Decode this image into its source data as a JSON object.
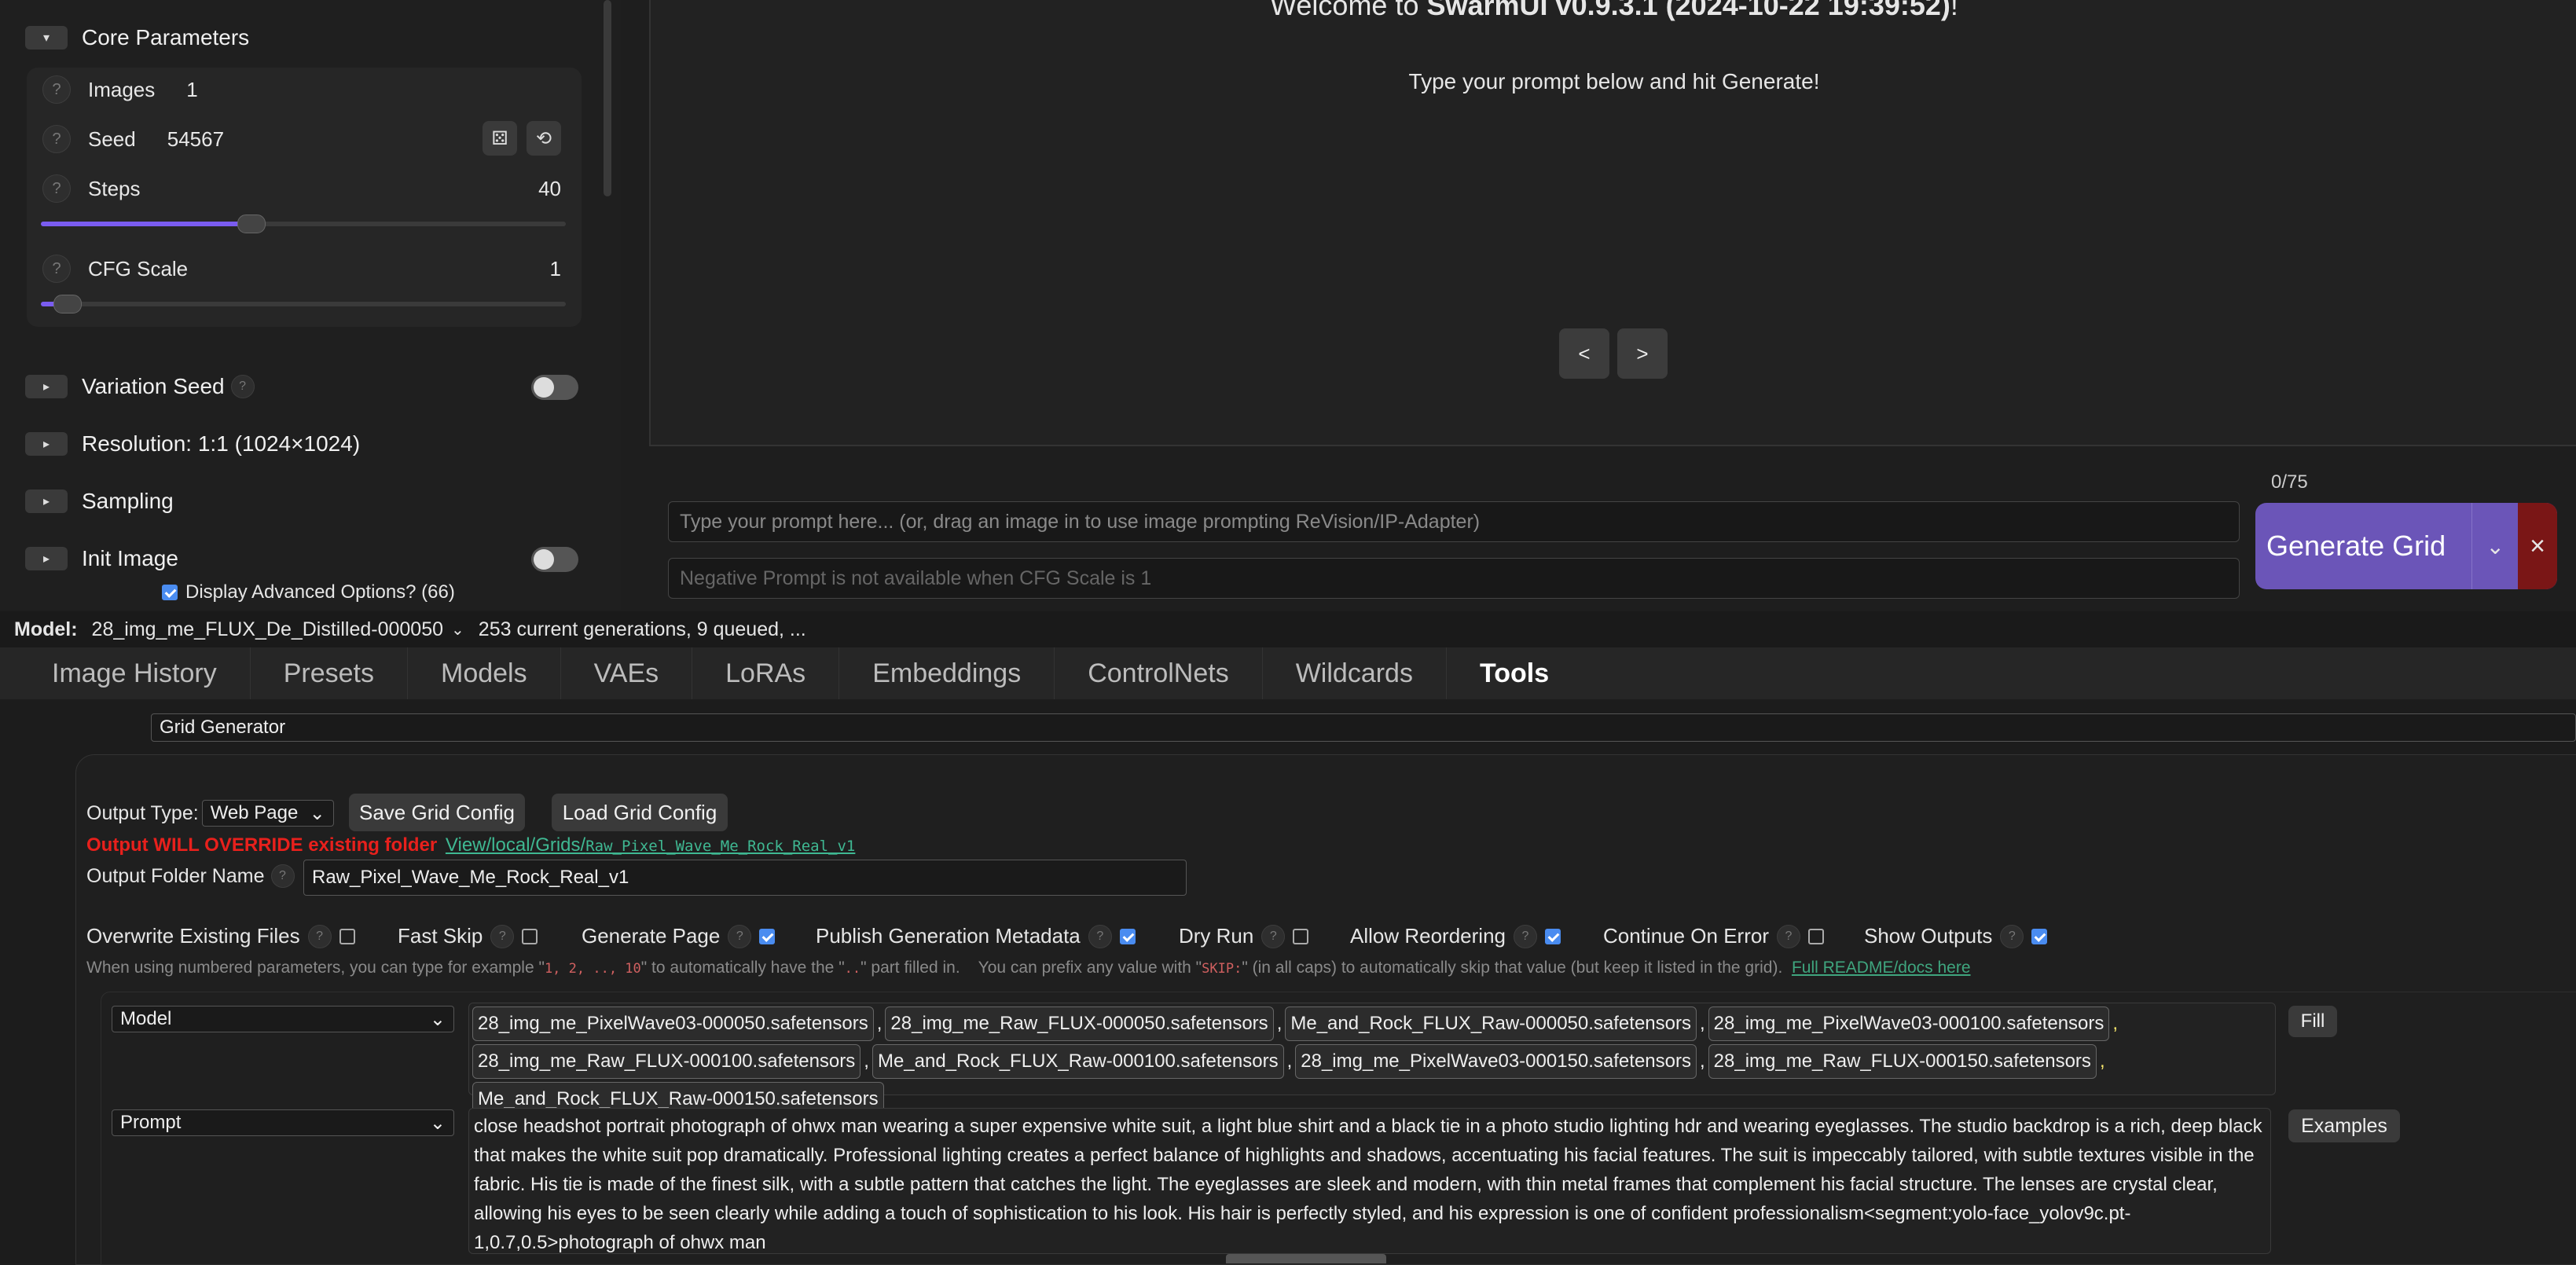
{
  "left_panel": {
    "core_parameters": {
      "label": "Core Parameters",
      "toggle": "▾"
    },
    "images": {
      "label": "Images",
      "value": "1"
    },
    "seed": {
      "label": "Seed",
      "value": "54567"
    },
    "steps": {
      "label": "Steps",
      "value": "40",
      "fill": 0.4
    },
    "cfg_scale": {
      "label": "CFG Scale",
      "value": "1",
      "fill": 0.05
    },
    "variation_seed": {
      "label": "Variation Seed"
    },
    "resolution": {
      "label": "Resolution: 1:1 (1024×1024)"
    },
    "sampling": {
      "label": "Sampling"
    },
    "init_image": {
      "label": "Init Image"
    },
    "advanced": {
      "label": "Display Advanced Options? (66)"
    }
  },
  "preview": {
    "welcome_prefix": "Welcome to ",
    "welcome_bold": "SwarmUI v0.9.3.1 (2024-10-22 19:39:52)",
    "welcome_suffix": "!",
    "hint": "Type your prompt below and hit Generate!",
    "prev": "<",
    "next": ">"
  },
  "prompt": {
    "counter": "0/75",
    "placeholder": "Type your prompt here... (or, drag an image in to use image prompting ReVision/IP-Adapter)",
    "negative": "Negative Prompt is not available when CFG Scale is 1",
    "generate_label": "Generate Grid",
    "close": "×"
  },
  "status": {
    "model_label": "Model:",
    "model_value": "28_img_me_FLUX_De_Distilled-000050",
    "queue": "253 current generations, 9 queued, ..."
  },
  "tabs": [
    "Image History",
    "Presets",
    "Models",
    "VAEs",
    "LoRAs",
    "Embeddings",
    "ControlNets",
    "Wildcards",
    "Tools"
  ],
  "tools": {
    "tool_select": "Grid Generator",
    "output_type_label": "Output Type:",
    "output_type_value": "Web Page",
    "save_config": "Save Grid Config",
    "load_config": "Load Grid Config",
    "override_warning": "Output WILL OVERRIDE existing folder",
    "folder_link": "View/local/Grids/",
    "folder_link_mono": "Raw_Pixel_Wave_Me_Rock_Real_v1",
    "folder_name_label": "Output Folder Name",
    "folder_name_value": "Raw_Pixel_Wave_Me_Rock_Real_v1",
    "options": [
      {
        "label": "Overwrite Existing Files",
        "checked": false
      },
      {
        "label": "Fast Skip",
        "checked": false
      },
      {
        "label": "Generate Page",
        "checked": true
      },
      {
        "label": "Publish Generation Metadata",
        "checked": true
      },
      {
        "label": "Dry Run",
        "checked": false
      },
      {
        "label": "Allow Reordering",
        "checked": true
      },
      {
        "label": "Continue On Error",
        "checked": false
      },
      {
        "label": "Show Outputs",
        "checked": true
      }
    ],
    "help_1": "When using numbered parameters, you can type for example \"",
    "help_1_mono": "1, 2, .., 10",
    "help_2": "\" to automatically have the \"",
    "help_2_mono": "..",
    "help_3": "\" part filled in.    You can prefix any value with \"",
    "help_3_mono": "SKIP:",
    "help_4": "\" (in all caps) to automatically skip that value (but keep it listed in the grid).",
    "readme_link": "Full README/docs here",
    "axis_model": "Model",
    "model_values": [
      "28_img_me_PixelWave03-000050.safetensors",
      "28_img_me_Raw_FLUX-000050.safetensors",
      "Me_and_Rock_FLUX_Raw-000050.safetensors",
      "28_img_me_PixelWave03-000100.safetensors",
      "28_img_me_Raw_FLUX-000100.safetensors",
      "Me_and_Rock_FLUX_Raw-000100.safetensors",
      "28_img_me_PixelWave03-000150.safetensors",
      "28_img_me_Raw_FLUX-000150.safetensors",
      "Me_and_Rock_FLUX_Raw-000150.safetensors"
    ],
    "fill_button": "Fill",
    "axis_prompt": "Prompt",
    "prompt_value": "close headshot portrait photograph of ohwx man wearing a super expensive white suit, a light blue shirt and a black tie in a photo studio lighting hdr and wearing eyeglasses. The studio backdrop is a rich, deep black that makes the white suit pop dramatically. Professional lighting creates a perfect balance of highlights and shadows, accentuating his facial features. The suit is impeccably tailored, with subtle textures visible in the fabric. His tie is made of the finest silk, with a subtle pattern that catches the light. The eyeglasses are sleek and modern, with thin metal frames that complement his facial structure. The lenses are crystal clear, allowing his eyes to be seen clearly while adding a touch of sophistication to his look. His hair is perfectly styled, and his expression is one of confident professionalism<segment:yolo-face_yolov9c.pt-1,0.7,0.5>photograph of ohwx man",
    "examples_button": "Examples"
  }
}
